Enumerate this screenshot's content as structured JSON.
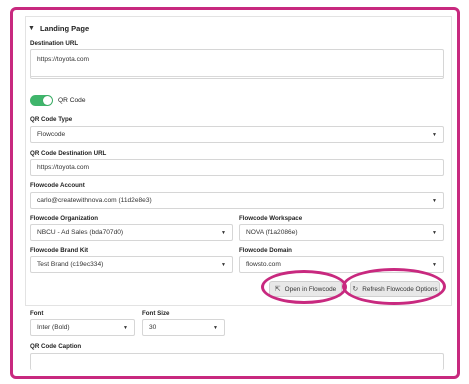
{
  "section": {
    "title": "Landing Page",
    "caret": "▼"
  },
  "destination_url": {
    "label": "Destination URL",
    "value": "https://toyota.com"
  },
  "qr_toggle": {
    "label": "QR Code",
    "on": true
  },
  "qr_code_type": {
    "label": "QR Code Type",
    "value": "Flowcode"
  },
  "qr_destination_url": {
    "label": "QR Code Destination URL",
    "value": "https://toyota.com"
  },
  "flowcode_account": {
    "label": "Flowcode Account",
    "value": "carlo@createwithnova.com (11d2e8e3)"
  },
  "flowcode_organization": {
    "label": "Flowcode Organization",
    "value": "NBCU - Ad Sales (bda707d0)"
  },
  "flowcode_workspace": {
    "label": "Flowcode Workspace",
    "value": "NOVA (f1a2086e)"
  },
  "flowcode_brand_kit": {
    "label": "Flowcode Brand Kit",
    "value": "Test Brand (c19ec334)"
  },
  "flowcode_domain": {
    "label": "Flowcode Domain",
    "value": "flowsto.com"
  },
  "buttons": {
    "open_flowcode": "Open in Flowcode",
    "refresh_options": "Refresh Flowcode Options"
  },
  "font": {
    "label": "Font",
    "value": "Inter (Bold)"
  },
  "font_size": {
    "label": "Font Size",
    "value": "30"
  },
  "qr_caption": {
    "label": "QR Code Caption"
  },
  "icons": {
    "dropdown": "triangle-down",
    "external": "external-link",
    "refresh": "refresh"
  },
  "colors": {
    "highlight": "#c8297f",
    "toggle_on": "#3fb56b"
  }
}
